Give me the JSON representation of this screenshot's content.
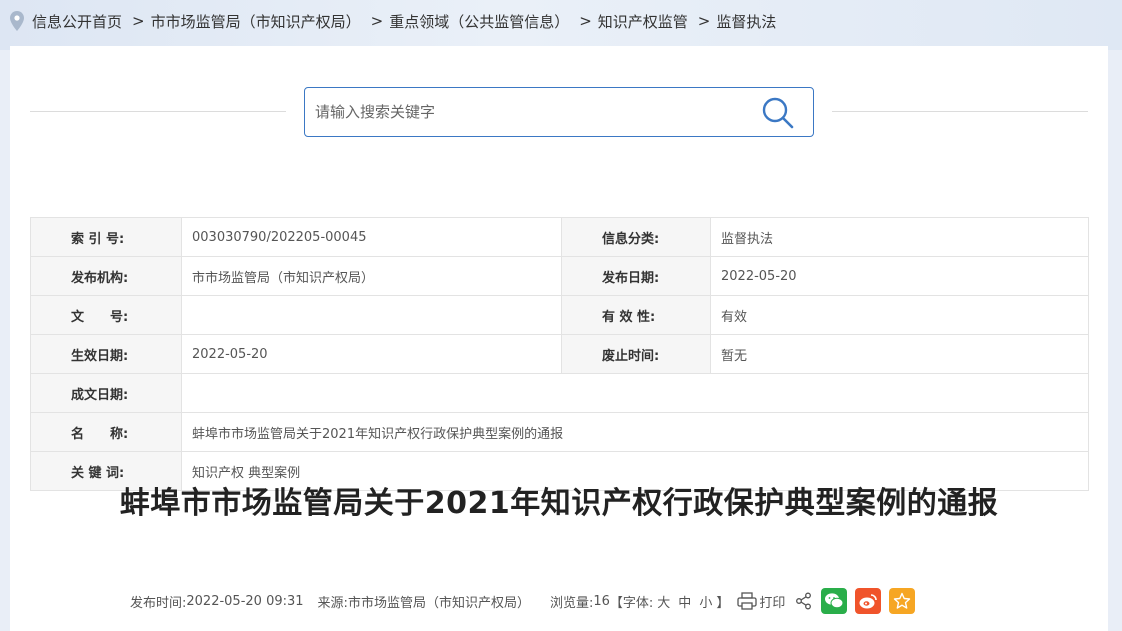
{
  "breadcrumb": {
    "items": [
      "信息公开首页",
      "市市场监管局（市知识产权局）",
      "重点领域（公共监管信息）",
      "知识产权监管",
      "监督执法"
    ],
    "separator": ">"
  },
  "search": {
    "placeholder": "请输入搜索关键字"
  },
  "meta": {
    "index_label": "索 引 号:",
    "index_value": "003030790/202205-00045",
    "category_label": "信息分类:",
    "category_value": "监督执法",
    "org_label": "发布机构:",
    "org_value": "市市场监管局（市知识产权局）",
    "pubdate_label": "发布日期:",
    "pubdate_value": "2022-05-20",
    "docno_label": "文　　号:",
    "docno_value": "",
    "validity_label": "有 效 性:",
    "validity_value": "有效",
    "effective_label": "生效日期:",
    "effective_value": "2022-05-20",
    "abolish_label": "废止时间:",
    "abolish_value": "暂无",
    "written_label": "成文日期:",
    "written_value": "",
    "name_label": "名　　称:",
    "name_value": "蚌埠市市场监管局关于2021年知识产权行政保护典型案例的通报",
    "keywords_label": "关 键 词:",
    "keywords_value": "知识产权 典型案例"
  },
  "article": {
    "title": "蚌埠市市场监管局关于2021年知识产权行政保护典型案例的通报",
    "pubtime_label": "发布时间:",
    "pubtime": "2022-05-20 09:31",
    "source_label": "来源:",
    "source": "市市场监管局（市知识产权局）",
    "views_label": "浏览量:",
    "views": "16",
    "font_open": "【字体:",
    "font_large": "大",
    "font_medium": "中",
    "font_small": "小",
    "font_close": "】",
    "print_label": "打印"
  },
  "colors": {
    "accent": "#3b78c4",
    "wechat": "#2aae4a",
    "weibo": "#f0542b",
    "favorite": "#f6a623"
  }
}
